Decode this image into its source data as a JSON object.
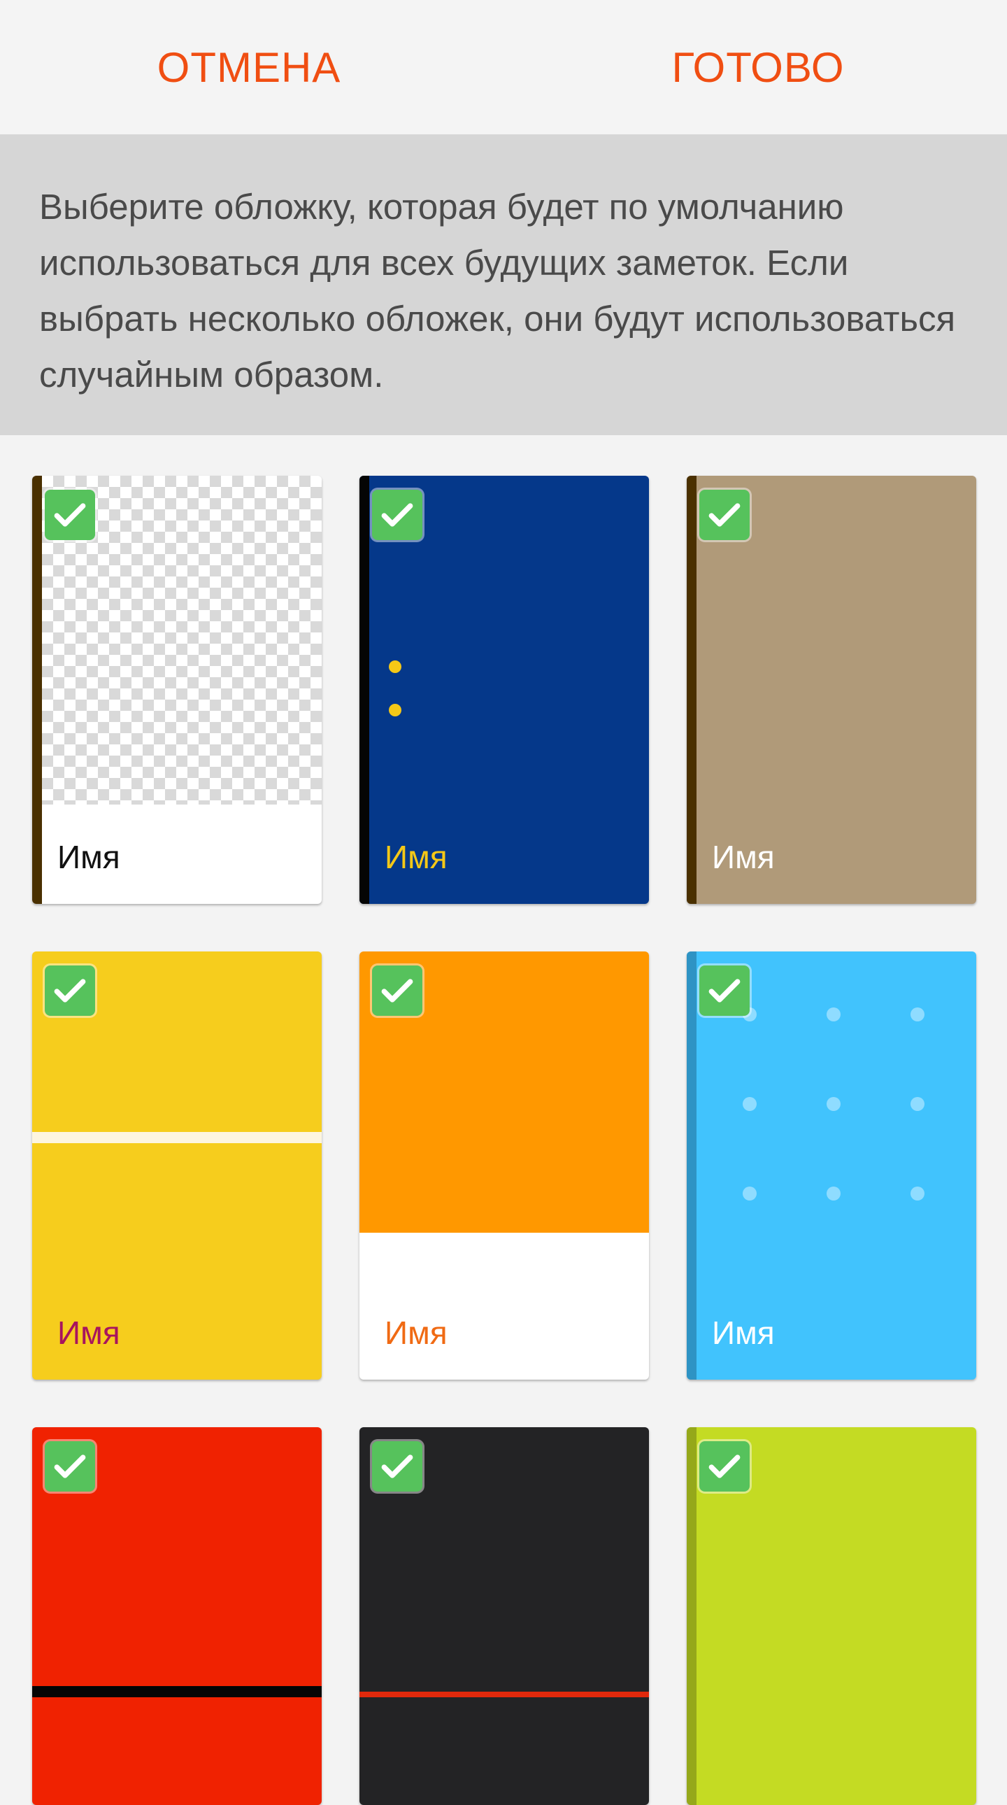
{
  "topbar": {
    "cancel_label": "ОТМЕНА",
    "done_label": "ГОТОВО",
    "accent_color": "#f04e12"
  },
  "info": {
    "text": "Выберите обложку, которая будет по умолчанию использоваться для всех будущих заметок. Если выбрать несколько обложек, они будут использоваться случайным образом."
  },
  "covers": [
    {
      "name": "Имя",
      "selected": true,
      "color": "#ffffff",
      "spine_color": "#4a3000",
      "label_color": "#111111",
      "style": "transparent"
    },
    {
      "name": "Имя",
      "selected": true,
      "color": "#05388a",
      "spine_color": "#050505",
      "label_color": "#f5c817",
      "style": "dots-yellow"
    },
    {
      "name": "Имя",
      "selected": true,
      "color": "#b09a79",
      "spine_color": "#4a3000",
      "label_color": "#ffffff",
      "style": "plain"
    },
    {
      "name": "Имя",
      "selected": true,
      "color": "#f6cd1d",
      "spine_color": "#f6cd1d",
      "label_color": "#a8145e",
      "style": "band-white"
    },
    {
      "name": "Имя",
      "selected": true,
      "color": "#ff9800",
      "spine_color": "#ff9800",
      "label_color": "#f06a13",
      "style": "half-white"
    },
    {
      "name": "Имя",
      "selected": true,
      "color": "#41c3fd",
      "spine_color": "#2e93c4",
      "label_color": "#ffffff",
      "style": "dot-grid"
    },
    {
      "name": "",
      "selected": true,
      "color": "#f02201",
      "spine_color": "#f02201",
      "label_color": "#ffffff",
      "style": "band-black"
    },
    {
      "name": "",
      "selected": true,
      "color": "#232325",
      "spine_color": "#232325",
      "label_color": "#ffffff",
      "style": "band-red"
    },
    {
      "name": "",
      "selected": true,
      "color": "#c4db23",
      "spine_color": "#95a81a",
      "label_color": "#ffffff",
      "style": "plain"
    }
  ]
}
